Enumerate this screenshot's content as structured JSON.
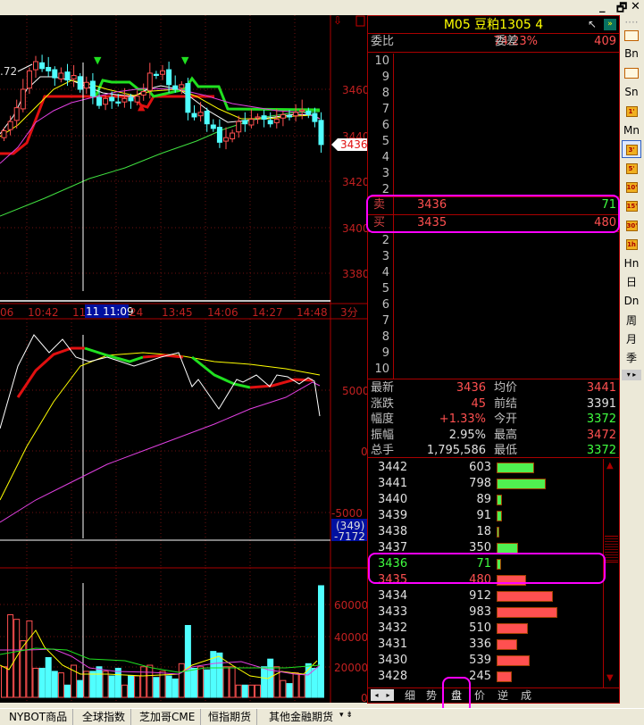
{
  "window": {
    "minimize": "_",
    "restore": "🗗",
    "close": "✕"
  },
  "chart": {
    "ma_label": ".72",
    "price_axis": [
      "3460",
      "3440",
      "3420",
      "3400",
      "3380"
    ],
    "current_price_tag": "3436",
    "time_axis": [
      "06",
      "10:42",
      "11",
      "24",
      "13:45",
      "14:06",
      "14:27",
      "14:48"
    ],
    "cursor_time": "11 11:09",
    "period": "3分",
    "indicator_axis": [
      "5000",
      "0",
      "-5000"
    ],
    "indicator_value_1": "(349)",
    "indicator_value_2": "-7172",
    "volume_axis": [
      "60000",
      "40000",
      "20000",
      "0"
    ]
  },
  "chart_data": {
    "type": "candlestick",
    "price_ylim": [
      3370,
      3490
    ],
    "closes": [
      3442,
      3446,
      3452,
      3460,
      3468,
      3472,
      3469,
      3468,
      3465,
      3467,
      3464,
      3466,
      3460,
      3463,
      3457,
      3453,
      3456,
      3455,
      3454,
      3456,
      3455,
      3457,
      3459,
      3467,
      3466,
      3468,
      3462,
      3460,
      3462,
      3450,
      3448,
      3450,
      3445,
      3443,
      3437,
      3439,
      3441,
      3446,
      3445,
      3447,
      3448,
      3447,
      3445,
      3447,
      3449,
      3448,
      3450,
      3451,
      3449,
      3446,
      3436
    ],
    "volume": [
      20000,
      54000,
      51000,
      37000,
      50000,
      19000,
      19000,
      26000,
      17000,
      16000,
      8000,
      21000,
      11000,
      17000,
      17000,
      20000,
      17000,
      14000,
      19000,
      8000,
      14000,
      14000,
      20000,
      21000,
      13000,
      17000,
      14000,
      12000,
      22000,
      47000,
      19000,
      20000,
      18000,
      30000,
      29000,
      20000,
      20000,
      8000,
      8000,
      8000,
      8000,
      20000,
      25000,
      20000,
      11000,
      9000,
      16000,
      15000,
      22000,
      19000,
      73000
    ],
    "volume_ylim": [
      0,
      80000
    ]
  },
  "quote": {
    "title": "M05  豆粕1305  4",
    "weibi_label": "委比",
    "weibi_value": "74.23%",
    "weicha_label": "委差",
    "weicha_value": "409",
    "ask_levels": [
      "10",
      "9",
      "8",
      "7",
      "6",
      "5",
      "4",
      "3",
      "2"
    ],
    "sell_label": "卖",
    "sell_price": "3436",
    "sell_volume": "71",
    "buy_label": "买",
    "buy_price": "3435",
    "buy_volume": "480",
    "bid_levels": [
      "2",
      "3",
      "4",
      "5",
      "6",
      "7",
      "8",
      "9",
      "10"
    ],
    "stats": [
      {
        "l1": "最新",
        "v1": "3436",
        "c1": "red",
        "l2": "均价",
        "v2": "3441",
        "c2": "red"
      },
      {
        "l1": "涨跌",
        "v1": "45",
        "c1": "red",
        "l2": "前结",
        "v2": "3391",
        "c2": "white"
      },
      {
        "l1": "幅度",
        "v1": "+1.33%",
        "c1": "red",
        "l2": "今开",
        "v2": "3372",
        "c2": "green"
      },
      {
        "l1": "振幅",
        "v1": "2.95%",
        "c1": "white",
        "l2": "最高",
        "v2": "3472",
        "c2": "red"
      },
      {
        "l1": "总手",
        "v1": "1,795,586",
        "c1": "white",
        "l2": "最低",
        "v2": "3372",
        "c2": "green"
      }
    ],
    "ladder": [
      {
        "price": "3442",
        "vol": 603,
        "side": "sell"
      },
      {
        "price": "3441",
        "vol": 798,
        "side": "sell"
      },
      {
        "price": "3440",
        "vol": 89,
        "side": "sell"
      },
      {
        "price": "3439",
        "vol": 91,
        "side": "sell"
      },
      {
        "price": "3438",
        "vol": 18,
        "side": "sell"
      },
      {
        "price": "3437",
        "vol": 350,
        "side": "sell"
      },
      {
        "price": "3436",
        "vol": 71,
        "side": "ask"
      },
      {
        "price": "3435",
        "vol": 480,
        "side": "bid"
      },
      {
        "price": "3434",
        "vol": 912,
        "side": "buy"
      },
      {
        "price": "3433",
        "vol": 983,
        "side": "buy"
      },
      {
        "price": "3432",
        "vol": 510,
        "side": "buy"
      },
      {
        "price": "3431",
        "vol": 336,
        "side": "buy"
      },
      {
        "price": "3430",
        "vol": 539,
        "side": "buy"
      },
      {
        "price": "3428",
        "vol": 245,
        "side": "buy"
      }
    ],
    "tabs": [
      "细",
      "势",
      "盘",
      "价",
      "逆",
      "成"
    ]
  },
  "side_toolbar": [
    "Bn",
    "Sn",
    "1'",
    "Mn",
    "3'",
    "5'",
    "10'",
    "15'",
    "30'",
    "1h",
    "Hn",
    "日",
    "Dn",
    "周",
    "月",
    "季"
  ],
  "bottom_tabs": [
    "NYBOT商品",
    "全球指数",
    "芝加哥CME",
    "恒指期货",
    "其他金融期货"
  ],
  "colors": {
    "up": "#ff5050",
    "down": "#50ffff",
    "highlight": "#ff00ff"
  }
}
